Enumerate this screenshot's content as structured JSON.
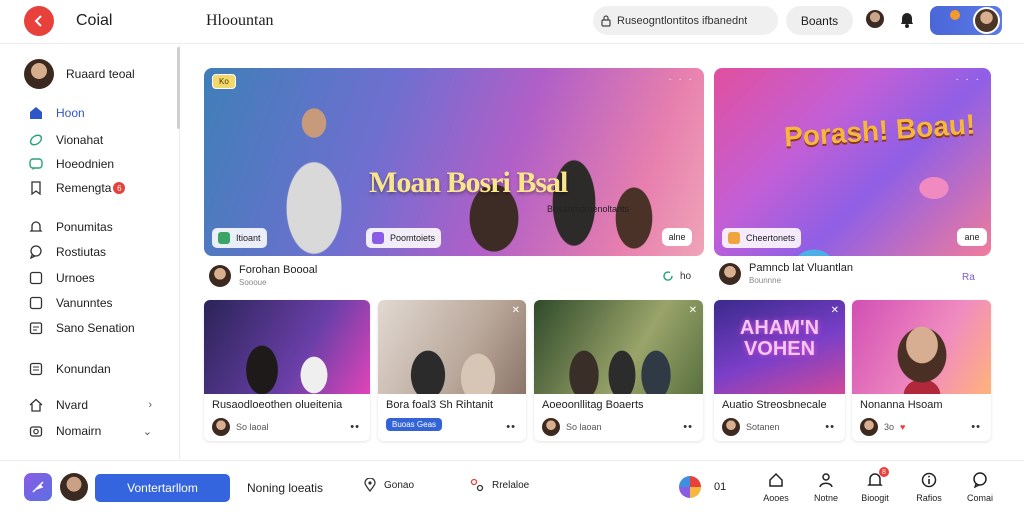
{
  "header": {
    "app_title": "Coial",
    "page_title": "Hloountan",
    "search_text": "Ruseogntlontitos ifbanednt",
    "browse_label": "Boants"
  },
  "sidebar": {
    "user_name": "Ruaard teoal",
    "items": [
      {
        "label": "Hoon",
        "icon": "home-icon",
        "active": true
      },
      {
        "label": "Vionahat",
        "icon": "leaf-icon"
      },
      {
        "label": "Hoeodnien",
        "icon": "chat-icon"
      },
      {
        "label": "Remengta",
        "icon": "bookmark-icon",
        "count": "6"
      },
      {
        "label": "Ponumitas",
        "icon": "bell-icon"
      },
      {
        "label": "Rostiutas",
        "icon": "speech-icon"
      },
      {
        "label": "Urnoes",
        "icon": "square-icon"
      },
      {
        "label": "Vanunntes",
        "icon": "square-icon"
      },
      {
        "label": "Sano Senation",
        "icon": "calendar-icon"
      },
      {
        "label": "Konundan",
        "icon": "list-icon"
      },
      {
        "label": "Nvard",
        "icon": "house-icon",
        "chevron": "›"
      },
      {
        "label": "Nomairn",
        "icon": "camera-icon",
        "chevron": "⌄"
      }
    ]
  },
  "hero1": {
    "tag": "Ko",
    "title": "Moan Bosri Bsal",
    "subtitle": "Bosaomdmenoltants",
    "chip1": "Itioant",
    "chip2": "Poomtoiets",
    "more": "alne",
    "author": "Forohan Boooal",
    "author_sub": "Soooue",
    "stat": "ho"
  },
  "hero2": {
    "title": "Porash! Boau!",
    "chip": "Cheertonets",
    "more": "ane",
    "author": "Pamncb lat Vluantlan",
    "author_sub": "Bounnne",
    "stat": "Ra"
  },
  "cards": [
    {
      "title": "Rusaodloeothen olueitenia",
      "foot": "So laoal"
    },
    {
      "title": "Bora foal3 Sh Rihtanit",
      "foot": "Buoas Geas",
      "pill": true
    },
    {
      "title": "Aoeoonllitag Boaerts",
      "foot": "So laoan"
    },
    {
      "title": "Auatio Streosbnecale",
      "foot": "Sotanen",
      "thumb_text": "AHAM'N VOHEN"
    },
    {
      "title": "Nonanna Hsoam",
      "foot": "3o"
    }
  ],
  "bottombar": {
    "primary_label": "Vontertarllom",
    "text": "Noning loeatis",
    "link1": "Gonao",
    "link2": "Rrelaloe",
    "orb_count": "01",
    "nav": [
      {
        "label": "Aooes",
        "icon": "home-icon"
      },
      {
        "label": "Notne",
        "icon": "profile-icon"
      },
      {
        "label": "Bioogit",
        "icon": "notification-icon",
        "badge": "8"
      },
      {
        "label": "Rafios",
        "icon": "info-icon"
      },
      {
        "label": "Comai",
        "icon": "chat-icon"
      }
    ]
  },
  "colors": {
    "accent": "#3565de",
    "red": "#e8413c",
    "hero_title": "#f9e58a"
  }
}
